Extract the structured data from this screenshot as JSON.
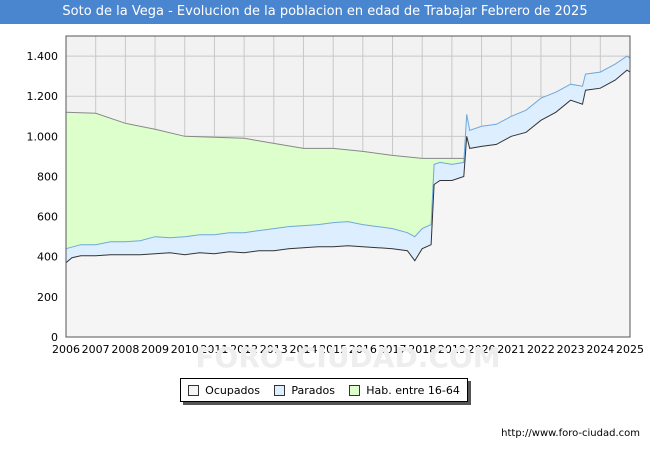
{
  "title": "Soto de la Vega - Evolucion de la poblacion en edad de Trabajar Febrero de 2025",
  "source": "http://www.foro-ciudad.com",
  "watermark": "FORO-CIUDAD.COM",
  "colors": {
    "title_bg": "#4a86cf",
    "plot_bg": "#f2f2f2",
    "grid": "#c8c8c8",
    "ocupados_fill": "#f5f5f5",
    "ocupados_line": "#333333",
    "parados_fill": "#ddeeff",
    "parados_line": "#6fa8dc",
    "hab_fill": "#ddffcc",
    "hab_line": "#888888"
  },
  "chart_data": {
    "type": "area",
    "title": "Soto de la Vega - Evolucion de la poblacion en edad de Trabajar Febrero de 2025",
    "xlabel": "",
    "ylabel": "",
    "xlim": [
      2006,
      2025
    ],
    "ylim": [
      0,
      1500
    ],
    "x_ticks": [
      "2006",
      "2007",
      "2008",
      "2009",
      "2010",
      "2011",
      "2012",
      "2013",
      "2014",
      "2015",
      "2016",
      "2017",
      "2018",
      "2019",
      "2020",
      "2021",
      "2022",
      "2023",
      "2024",
      "2025"
    ],
    "y_ticks": [
      "0",
      "200",
      "400",
      "600",
      "800",
      "1.000",
      "1.200",
      "1.400"
    ],
    "y_tick_values": [
      0,
      200,
      400,
      600,
      800,
      1000,
      1200,
      1400
    ],
    "grid": true,
    "legend_position": "bottom",
    "series": [
      {
        "name": "Ocupados",
        "points": [
          [
            2006.0,
            370
          ],
          [
            2006.2,
            395
          ],
          [
            2006.5,
            405
          ],
          [
            2007.0,
            405
          ],
          [
            2007.5,
            410
          ],
          [
            2008.0,
            410
          ],
          [
            2008.5,
            410
          ],
          [
            2009.0,
            415
          ],
          [
            2009.5,
            420
          ],
          [
            2010.0,
            410
          ],
          [
            2010.5,
            420
          ],
          [
            2011.0,
            415
          ],
          [
            2011.5,
            425
          ],
          [
            2012.0,
            420
          ],
          [
            2012.5,
            430
          ],
          [
            2013.0,
            430
          ],
          [
            2013.5,
            440
          ],
          [
            2014.0,
            445
          ],
          [
            2014.5,
            450
          ],
          [
            2015.0,
            450
          ],
          [
            2015.5,
            455
          ],
          [
            2016.0,
            450
          ],
          [
            2016.5,
            445
          ],
          [
            2017.0,
            440
          ],
          [
            2017.5,
            430
          ],
          [
            2017.75,
            380
          ],
          [
            2018.0,
            440
          ],
          [
            2018.3,
            460
          ],
          [
            2018.4,
            760
          ],
          [
            2018.6,
            780
          ],
          [
            2019.0,
            780
          ],
          [
            2019.4,
            800
          ],
          [
            2019.5,
            1000
          ],
          [
            2019.6,
            940
          ],
          [
            2020.0,
            950
          ],
          [
            2020.5,
            960
          ],
          [
            2021.0,
            1000
          ],
          [
            2021.5,
            1020
          ],
          [
            2022.0,
            1080
          ],
          [
            2022.5,
            1120
          ],
          [
            2023.0,
            1180
          ],
          [
            2023.4,
            1160
          ],
          [
            2023.5,
            1230
          ],
          [
            2024.0,
            1240
          ],
          [
            2024.5,
            1280
          ],
          [
            2024.9,
            1330
          ],
          [
            2025.0,
            1320
          ]
        ]
      },
      {
        "name": "Parados",
        "points": [
          [
            2006.0,
            440
          ],
          [
            2006.5,
            460
          ],
          [
            2007.0,
            460
          ],
          [
            2007.5,
            475
          ],
          [
            2008.0,
            475
          ],
          [
            2008.5,
            480
          ],
          [
            2009.0,
            500
          ],
          [
            2009.5,
            495
          ],
          [
            2010.0,
            500
          ],
          [
            2010.5,
            510
          ],
          [
            2011.0,
            510
          ],
          [
            2011.5,
            520
          ],
          [
            2012.0,
            520
          ],
          [
            2012.5,
            530
          ],
          [
            2013.0,
            540
          ],
          [
            2013.5,
            550
          ],
          [
            2014.0,
            555
          ],
          [
            2014.5,
            560
          ],
          [
            2015.0,
            570
          ],
          [
            2015.5,
            575
          ],
          [
            2016.0,
            560
          ],
          [
            2016.5,
            550
          ],
          [
            2017.0,
            540
          ],
          [
            2017.5,
            520
          ],
          [
            2017.75,
            500
          ],
          [
            2018.0,
            540
          ],
          [
            2018.3,
            560
          ],
          [
            2018.4,
            860
          ],
          [
            2018.6,
            870
          ],
          [
            2019.0,
            860
          ],
          [
            2019.4,
            870
          ],
          [
            2019.5,
            1110
          ],
          [
            2019.6,
            1030
          ],
          [
            2020.0,
            1050
          ],
          [
            2020.5,
            1060
          ],
          [
            2021.0,
            1100
          ],
          [
            2021.5,
            1130
          ],
          [
            2022.0,
            1190
          ],
          [
            2022.5,
            1220
          ],
          [
            2023.0,
            1260
          ],
          [
            2023.4,
            1250
          ],
          [
            2023.5,
            1310
          ],
          [
            2024.0,
            1320
          ],
          [
            2024.5,
            1360
          ],
          [
            2024.9,
            1400
          ],
          [
            2025.0,
            1390
          ]
        ]
      },
      {
        "name": "Hab. entre 16-64",
        "points": [
          [
            2006.0,
            1120
          ],
          [
            2007.0,
            1115
          ],
          [
            2008.0,
            1065
          ],
          [
            2009.0,
            1035
          ],
          [
            2010.0,
            1000
          ],
          [
            2011.0,
            995
          ],
          [
            2012.0,
            990
          ],
          [
            2013.0,
            965
          ],
          [
            2014.0,
            940
          ],
          [
            2015.0,
            940
          ],
          [
            2016.0,
            925
          ],
          [
            2017.0,
            905
          ],
          [
            2018.0,
            890
          ],
          [
            2019.0,
            890
          ],
          [
            2019.6,
            890
          ]
        ]
      }
    ]
  }
}
